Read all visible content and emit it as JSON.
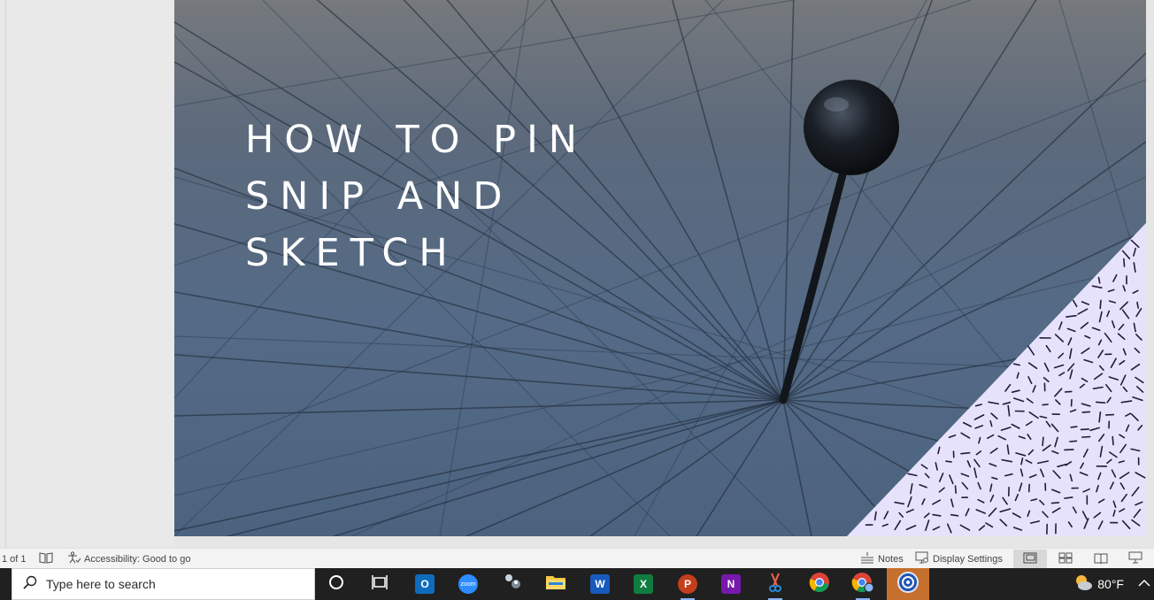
{
  "slide": {
    "title_lines": [
      "HOW TO PIN",
      "SNIP AND",
      "SKETCH"
    ]
  },
  "statusbar": {
    "slide_count": "1 of 1",
    "accessibility": "Accessibility: Good to go",
    "notes_label": "Notes",
    "display_settings_label": "Display Settings"
  },
  "taskbar": {
    "search_placeholder": "Type here to search",
    "apps": [
      "outlook",
      "zoom",
      "people",
      "file-explorer",
      "word",
      "excel",
      "powerpoint",
      "onenote",
      "snip-and-sketch",
      "chrome",
      "chrome-profile",
      "security-app"
    ],
    "app_labels": {
      "outlook": "O",
      "word": "W",
      "excel": "X",
      "powerpoint": "P",
      "onenote": "N",
      "zoom": "zoom"
    },
    "temperature": "80°F"
  },
  "colors": {
    "slide_bg": "#5b6e86",
    "accent_triangle": "#e7e2fb",
    "taskbar_bg": "#202020"
  }
}
